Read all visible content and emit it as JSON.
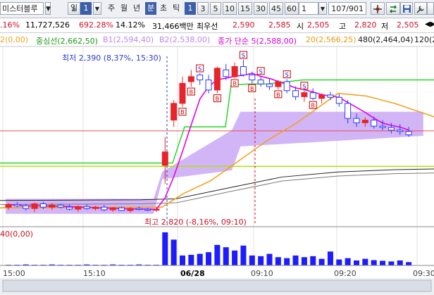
{
  "toolbar": {
    "stock_name": "미스터블루",
    "items": [
      "!",
      "일",
      "1",
      "주",
      "월",
      "년",
      "분",
      "초",
      "틱",
      "1",
      "3",
      "5",
      "10",
      "15",
      "30",
      "45",
      "60"
    ],
    "count_value": "1",
    "page_indicator": "107/901"
  },
  "info": {
    "change_pct": ".16%",
    "volume": "11,727,526",
    "vol_ratio": "692.28%",
    "turnover": "14.12%",
    "amount": "31,466백만",
    "best_label": "최우선",
    "best_ask": "2,590",
    "best_bid": "2,585",
    "open_label": "시",
    "open": "2,505",
    "high_label": "고",
    "high": "2,820",
    "low_label": "저",
    "low": "2,505"
  },
  "legend": {
    "l1": "2(0,00)",
    "l2": "중심선(2,662,50)",
    "l3": "B1(2,594,40)",
    "l4": "B2(2,538,00)",
    "l5": "종가 단순 5(2,588,00)",
    "l6": "20(2,566,25)",
    "l7": "480(2,464,04)",
    "l8": "120(2"
  },
  "annotations": {
    "low_note": "최저 2,390 (8,37%, 15:30)",
    "high_note": "최고 2,820 (-8,16%, 09:10)",
    "volume_legend": "40(0,00)"
  },
  "x_labels": [
    "15:00",
    "15:10",
    "06/28",
    "09:10",
    "09:20",
    "09:30"
  ],
  "colors": {
    "up": "#e8232a",
    "down": "#2b3aff",
    "ma5": "#e600e6",
    "ma20": "#f2a21e",
    "cloud": "#c9a8f5",
    "base_line": "#2bd62b",
    "volume": "#1c1cff",
    "signal_box": "#cc0000"
  },
  "chart_data": {
    "type": "candlestick",
    "candles": [
      {
        "t": 0,
        "o": 2380,
        "h": 2392,
        "l": 2372,
        "c": 2388
      },
      {
        "t": 1,
        "o": 2388,
        "h": 2395,
        "l": 2380,
        "c": 2384
      },
      {
        "t": 2,
        "o": 2384,
        "h": 2390,
        "l": 2370,
        "c": 2376
      },
      {
        "t": 3,
        "o": 2376,
        "h": 2394,
        "l": 2366,
        "c": 2390
      },
      {
        "t": 4,
        "o": 2390,
        "h": 2396,
        "l": 2374,
        "c": 2380
      },
      {
        "t": 5,
        "o": 2380,
        "h": 2392,
        "l": 2372,
        "c": 2386
      },
      {
        "t": 6,
        "o": 2386,
        "h": 2390,
        "l": 2376,
        "c": 2380
      },
      {
        "t": 7,
        "o": 2380,
        "h": 2388,
        "l": 2370,
        "c": 2374
      },
      {
        "t": 8,
        "o": 2374,
        "h": 2385,
        "l": 2366,
        "c": 2382
      },
      {
        "t": 9,
        "o": 2382,
        "h": 2388,
        "l": 2372,
        "c": 2376
      },
      {
        "t": 10,
        "o": 2376,
        "h": 2384,
        "l": 2370,
        "c": 2380
      },
      {
        "t": 11,
        "o": 2380,
        "h": 2386,
        "l": 2368,
        "c": 2372
      },
      {
        "t": 12,
        "o": 2372,
        "h": 2380,
        "l": 2366,
        "c": 2378
      },
      {
        "t": 13,
        "o": 2378,
        "h": 2382,
        "l": 2368,
        "c": 2370
      },
      {
        "t": 14,
        "o": 2370,
        "h": 2380,
        "l": 2364,
        "c": 2376
      },
      {
        "t": 15,
        "o": 2376,
        "h": 2382,
        "l": 2370,
        "c": 2374
      },
      {
        "t": 16,
        "o": 2374,
        "h": 2378,
        "l": 2368,
        "c": 2372
      },
      {
        "t": 17,
        "o": 2372,
        "h": 2380,
        "l": 2366,
        "c": 2374
      },
      {
        "t": 18,
        "o": 2505,
        "h": 2590,
        "l": 2450,
        "c": 2545
      },
      {
        "t": 19,
        "o": 2640,
        "h": 2700,
        "l": 2620,
        "c": 2690
      },
      {
        "t": 20,
        "o": 2690,
        "h": 2770,
        "l": 2680,
        "c": 2750
      },
      {
        "t": 21,
        "o": 2755,
        "h": 2790,
        "l": 2740,
        "c": 2770
      },
      {
        "t": 22,
        "o": 2775,
        "h": 2780,
        "l": 2745,
        "c": 2760
      },
      {
        "t": 23,
        "o": 2760,
        "h": 2775,
        "l": 2720,
        "c": 2730
      },
      {
        "t": 24,
        "o": 2730,
        "h": 2800,
        "l": 2720,
        "c": 2795
      },
      {
        "t": 25,
        "o": 2790,
        "h": 2808,
        "l": 2760,
        "c": 2770
      },
      {
        "t": 26,
        "o": 2770,
        "h": 2812,
        "l": 2765,
        "c": 2800
      },
      {
        "t": 27,
        "o": 2800,
        "h": 2820,
        "l": 2770,
        "c": 2775
      },
      {
        "t": 28,
        "o": 2775,
        "h": 2785,
        "l": 2750,
        "c": 2760
      },
      {
        "t": 29,
        "o": 2760,
        "h": 2772,
        "l": 2740,
        "c": 2748
      },
      {
        "t": 30,
        "o": 2748,
        "h": 2765,
        "l": 2730,
        "c": 2740
      },
      {
        "t": 31,
        "o": 2740,
        "h": 2760,
        "l": 2732,
        "c": 2755
      },
      {
        "t": 32,
        "o": 2755,
        "h": 2762,
        "l": 2720,
        "c": 2728
      },
      {
        "t": 33,
        "o": 2728,
        "h": 2740,
        "l": 2700,
        "c": 2710
      },
      {
        "t": 34,
        "o": 2710,
        "h": 2728,
        "l": 2695,
        "c": 2722
      },
      {
        "t": 35,
        "o": 2722,
        "h": 2735,
        "l": 2700,
        "c": 2705
      },
      {
        "t": 36,
        "o": 2705,
        "h": 2720,
        "l": 2690,
        "c": 2715
      },
      {
        "t": 37,
        "o": 2715,
        "h": 2725,
        "l": 2700,
        "c": 2708
      },
      {
        "t": 38,
        "o": 2708,
        "h": 2718,
        "l": 2680,
        "c": 2690
      },
      {
        "t": 39,
        "o": 2690,
        "h": 2700,
        "l": 2630,
        "c": 2645
      },
      {
        "t": 40,
        "o": 2645,
        "h": 2660,
        "l": 2620,
        "c": 2632
      },
      {
        "t": 41,
        "o": 2632,
        "h": 2648,
        "l": 2620,
        "c": 2640
      },
      {
        "t": 42,
        "o": 2640,
        "h": 2650,
        "l": 2615,
        "c": 2622
      },
      {
        "t": 43,
        "o": 2622,
        "h": 2640,
        "l": 2610,
        "c": 2618
      },
      {
        "t": 44,
        "o": 2618,
        "h": 2632,
        "l": 2600,
        "c": 2610
      },
      {
        "t": 45,
        "o": 2610,
        "h": 2628,
        "l": 2596,
        "c": 2606
      },
      {
        "t": 46,
        "o": 2606,
        "h": 2620,
        "l": 2590,
        "c": 2596
      }
    ]
  }
}
